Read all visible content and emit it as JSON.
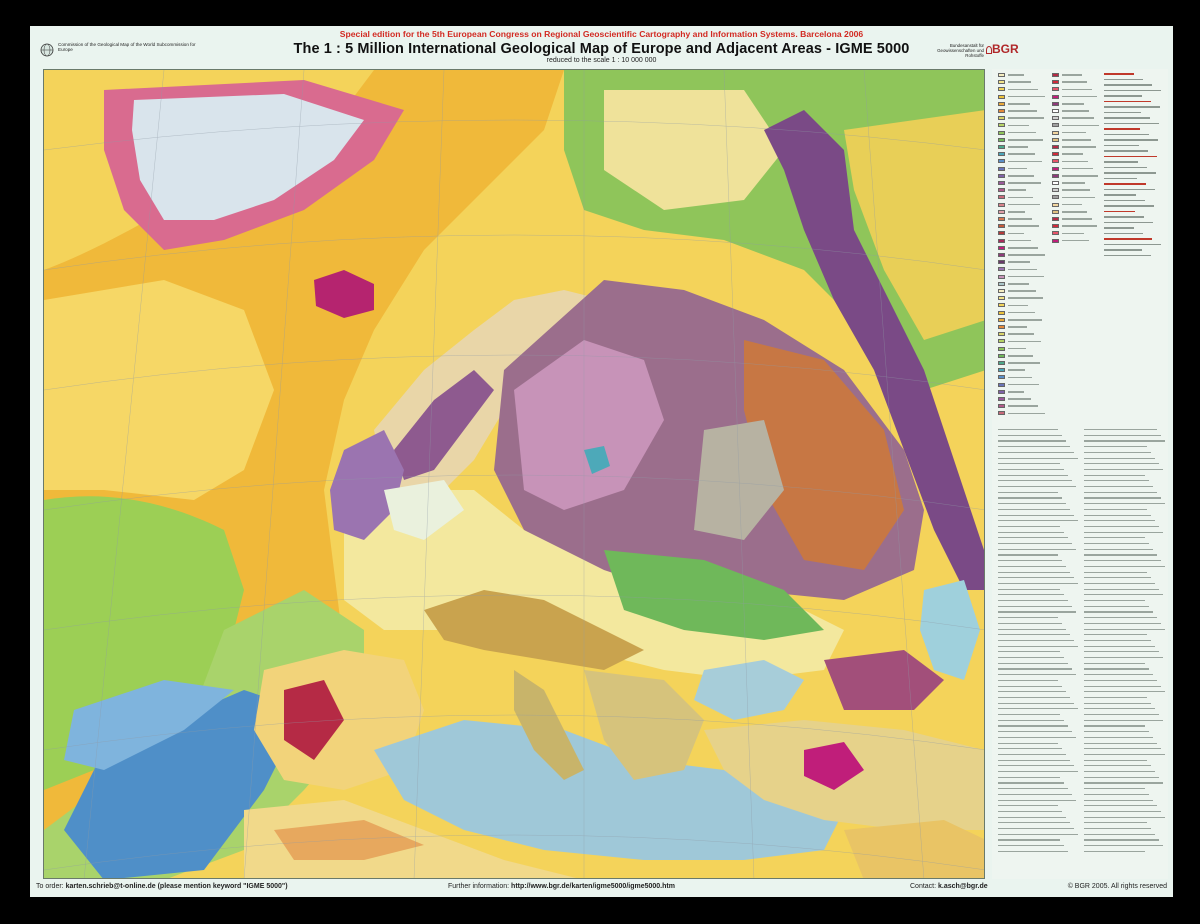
{
  "header": {
    "special_edition": "Special edition for the 5th European Congress on Regional Geoscientific Cartography and Information Systems. Barcelona 2006",
    "title": "The 1 : 5 Million International Geological Map of Europe and Adjacent Areas - IGME 5000",
    "subtitle": "reduced to the scale 1 : 10 000 000",
    "commission_text": "Commission of the Geological Map of the World Subcommission for Europe",
    "bgr_text": "Bundesanstalt für Geowissenschaften und Rohstoffe",
    "bgr_name": "BGR"
  },
  "footer": {
    "order_label": "To order:",
    "order_contact": "karten.schrieb@t-online.de (please mention keyword \"IGME 5000\")",
    "info_label": "Further information:",
    "info_url": "http://www.bgr.de/karten/igme5000/igme5000.htm",
    "contact_label": "Contact:",
    "contact_email": "k.asch@bgr.de",
    "copyright": "© BGR 2005. All rights reserved"
  },
  "colors": {
    "frame": "#000000",
    "sheet": "#eaf4ef",
    "special_edition_red": "#d22a22",
    "ocean_yellow": "#f2cc3e",
    "greenland_ice": "#d9e4ec",
    "russian_platform": "#9b6e8c",
    "mediterranean_blue": "#9fc8d8",
    "atlantic_green": "#9ccf55"
  }
}
